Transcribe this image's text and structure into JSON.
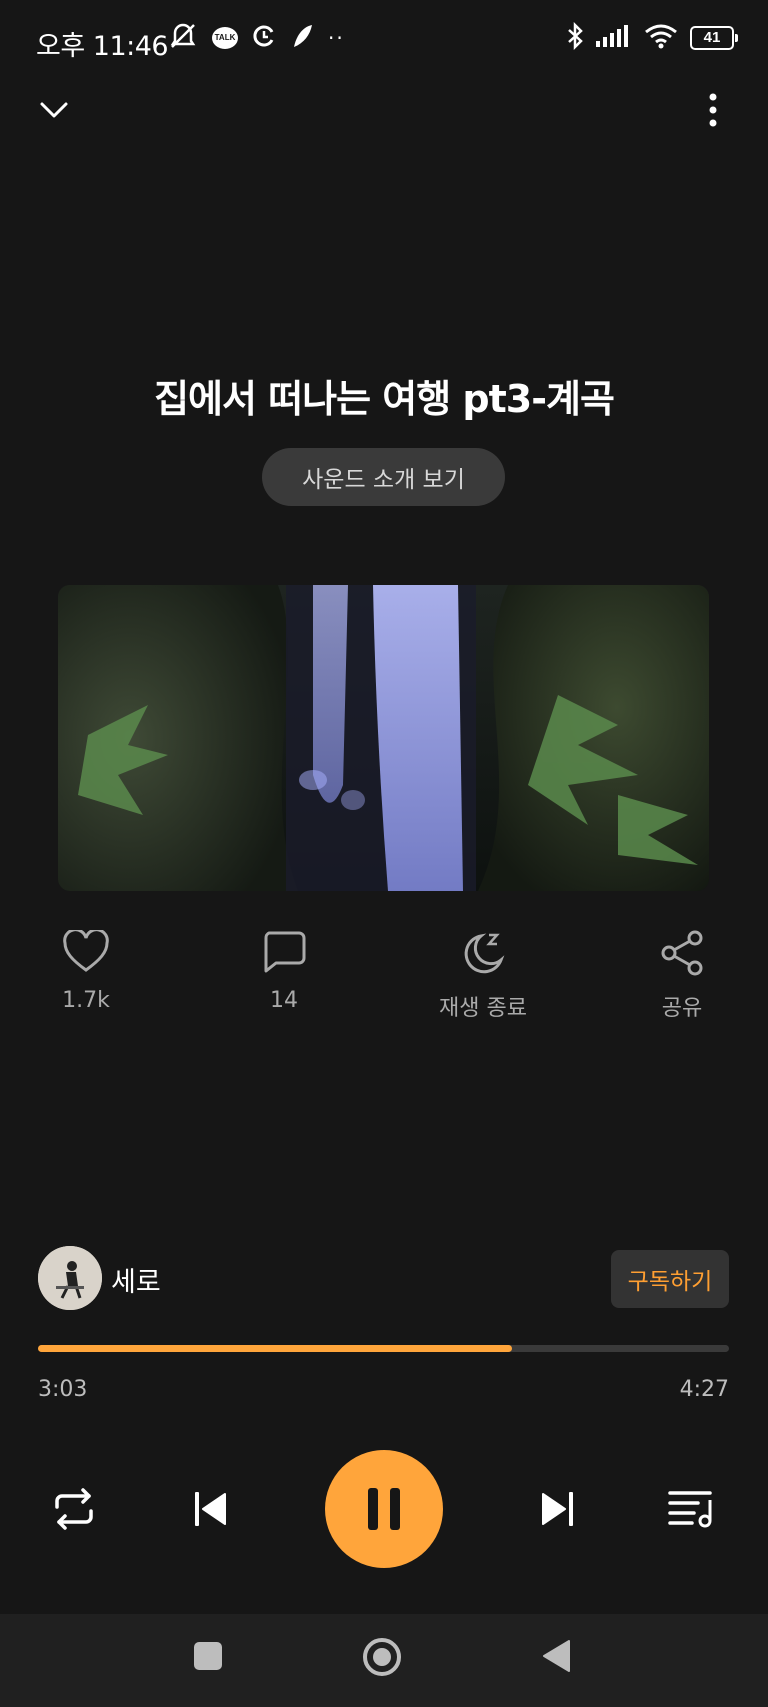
{
  "status_bar": {
    "time": "오후 11:46",
    "talk_badge": "TALK",
    "battery": "41"
  },
  "track": {
    "title": "집에서 떠나는 여행 pt3-계곡",
    "intro_button": "사운드 소개 보기"
  },
  "actions": {
    "likes": "1.7k",
    "comments": "14",
    "sleep_timer": "재생 종료",
    "share": "공유"
  },
  "artist": {
    "name": "세로",
    "subscribe_label": "구독하기"
  },
  "progress": {
    "current": "3:03",
    "total": "4:27",
    "fraction": 0.686
  },
  "colors": {
    "accent": "#ffa53b",
    "background": "#161616"
  }
}
